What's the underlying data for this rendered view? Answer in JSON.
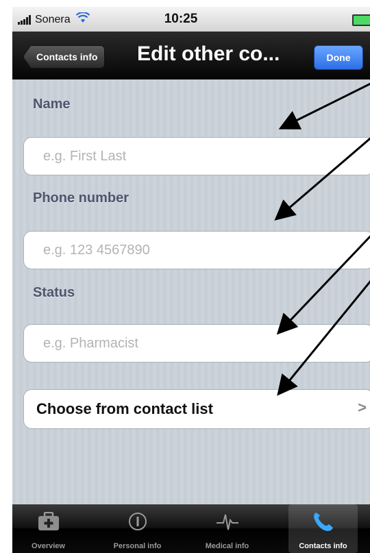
{
  "status_bar": {
    "carrier": "Sonera",
    "time": "10:25"
  },
  "nav": {
    "back_label": "Contacts info",
    "title": "Edit other co...",
    "done_label": "Done"
  },
  "form": {
    "name_label": "Name",
    "name_placeholder": "e.g. First Last",
    "phone_label": "Phone number",
    "phone_placeholder": "e.g. 123 4567890",
    "status_label": "Status",
    "status_placeholder": "e.g. Pharmacist",
    "choose_label": "Choose from contact list",
    "choose_chevron": ">"
  },
  "tabs": [
    {
      "label": "Overview",
      "icon": "first-aid-kit-icon"
    },
    {
      "label": "Personal info",
      "icon": "info-icon"
    },
    {
      "label": "Medical info",
      "icon": "heartbeat-icon"
    },
    {
      "label": "Contacts info",
      "icon": "phone-handset-icon",
      "active": true
    }
  ],
  "colors": {
    "accent": "#2c6fe6",
    "battery": "#4cd964",
    "annotation_arrows": "#000000"
  }
}
